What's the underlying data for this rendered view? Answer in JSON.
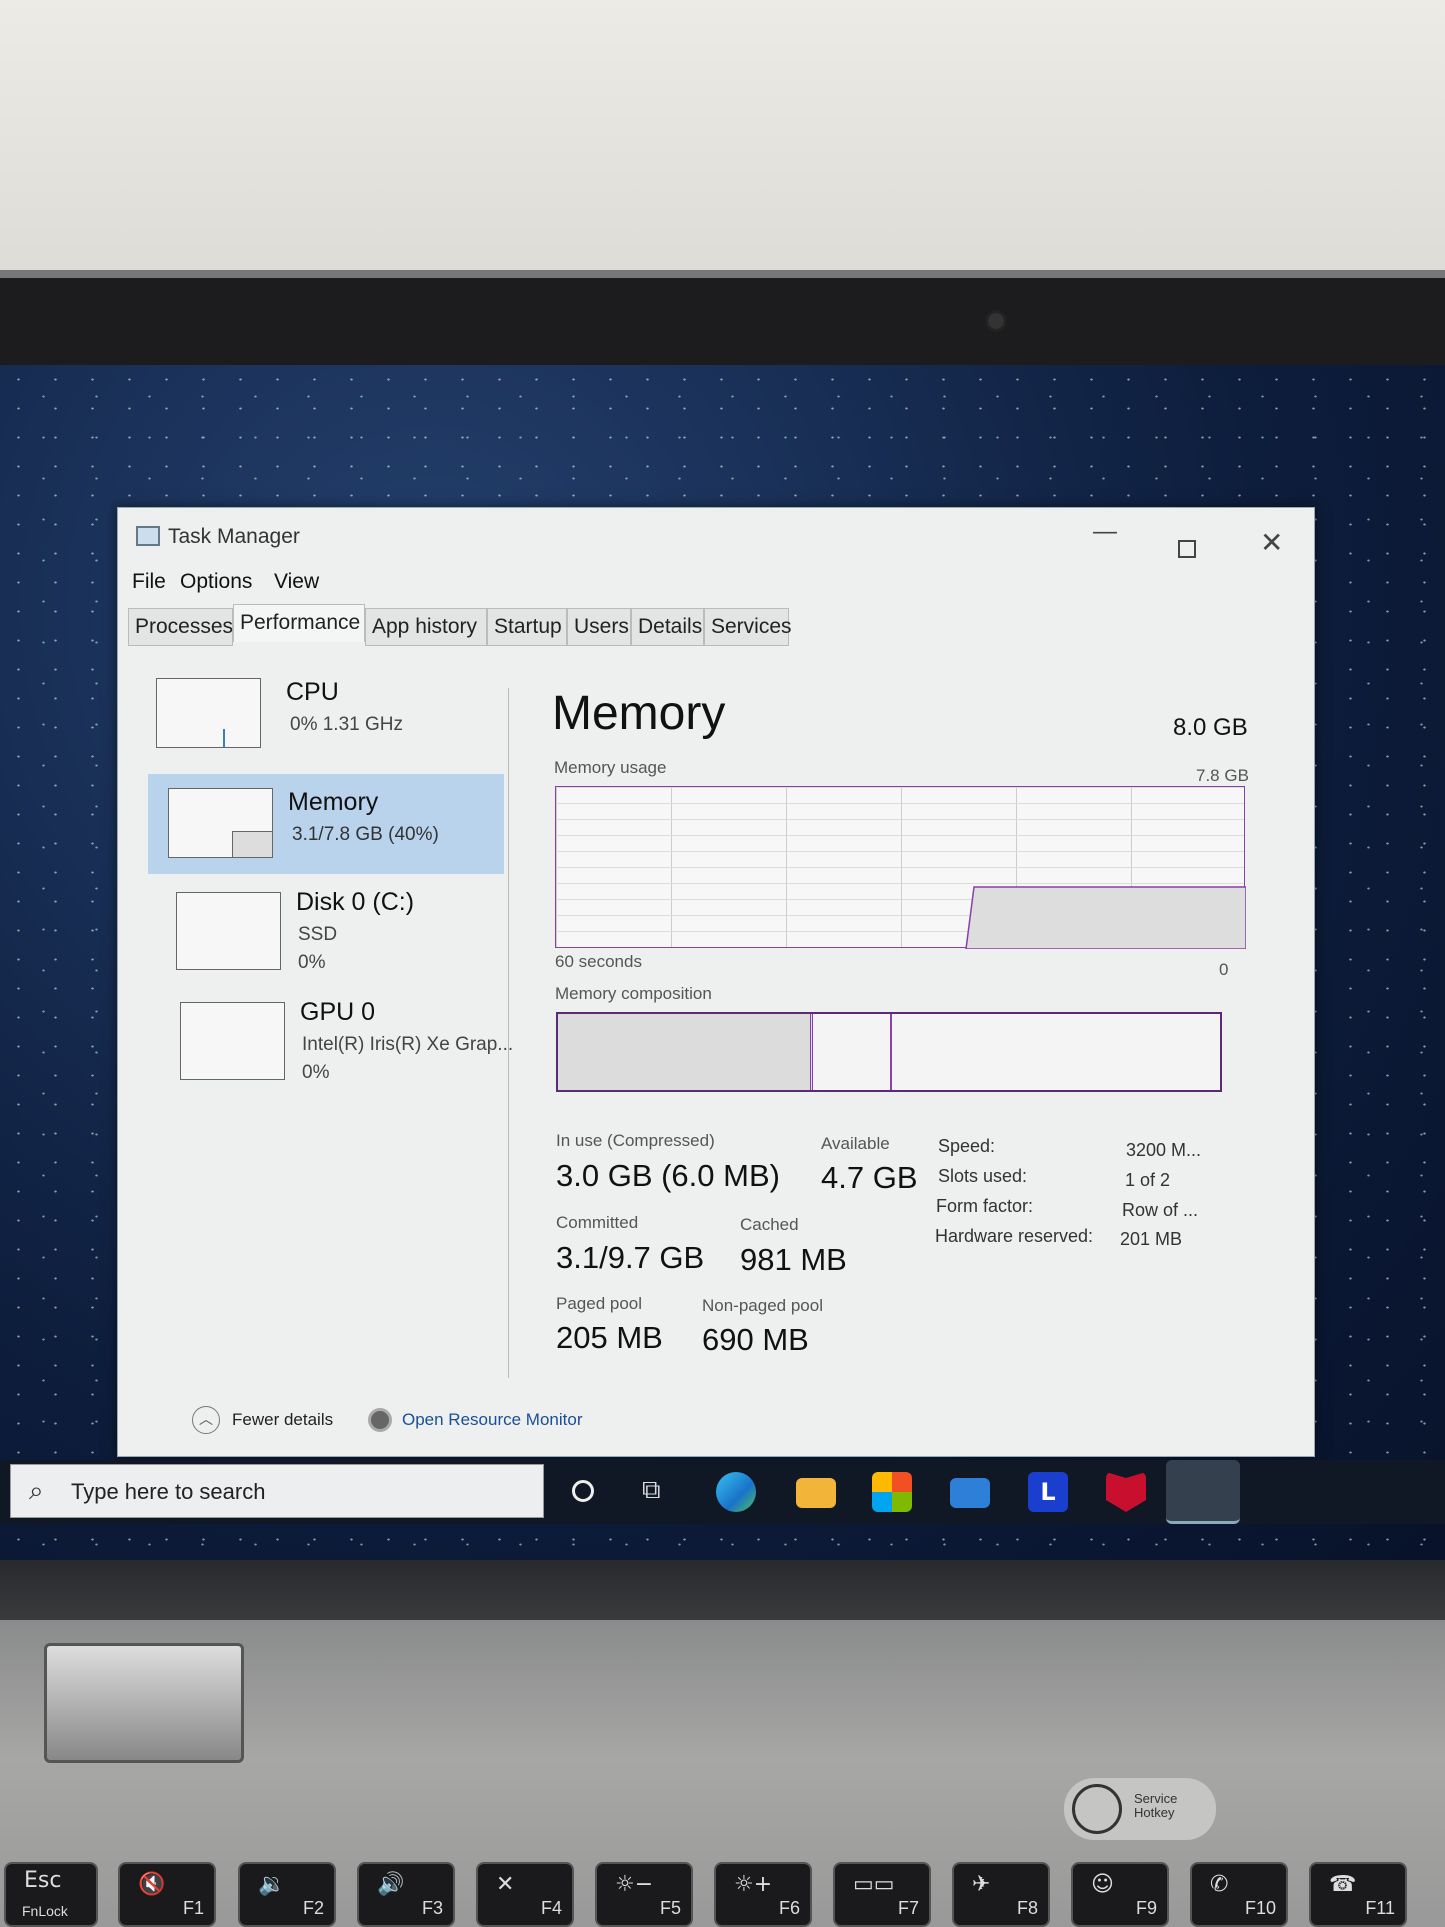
{
  "window": {
    "title": "Task Manager",
    "menu": [
      "File",
      "Options",
      "View"
    ],
    "tabs": [
      "Processes",
      "Performance",
      "App history",
      "Startup",
      "Users",
      "Details",
      "Services"
    ],
    "active_tab": "Performance"
  },
  "sidebar": [
    {
      "name": "CPU",
      "line1": "0%  1.31 GHz"
    },
    {
      "name": "Memory",
      "line1": "3.1/7.8 GB (40%)",
      "selected": true
    },
    {
      "name": "Disk 0 (C:)",
      "line1": "SSD",
      "line2": "0%"
    },
    {
      "name": "GPU 0",
      "line1": "Intel(R) Iris(R) Xe Grap...",
      "line2": "0%"
    }
  ],
  "main": {
    "title": "Memory",
    "total": "8.0 GB",
    "usage_label": "Memory usage",
    "usage_max": "7.8 GB",
    "time_label": "60 seconds",
    "zero": "0",
    "composition_label": "Memory composition",
    "usage_percent": 40,
    "stats": [
      {
        "label": "In use (Compressed)",
        "value": "3.0 GB (6.0 MB)"
      },
      {
        "label": "Available",
        "value": "4.7 GB"
      },
      {
        "label": "Committed",
        "value": "3.1/9.7 GB"
      },
      {
        "label": "Cached",
        "value": "981 MB"
      },
      {
        "label": "Paged pool",
        "value": "205 MB"
      },
      {
        "label": "Non-paged pool",
        "value": "690 MB"
      }
    ],
    "specs": [
      {
        "label": "Speed:",
        "value": "3200 M..."
      },
      {
        "label": "Slots used:",
        "value": "1 of 2"
      },
      {
        "label": "Form factor:",
        "value": "Row of ..."
      },
      {
        "label": "Hardware reserved:",
        "value": "201 MB"
      }
    ]
  },
  "footer": {
    "fewer": "Fewer details",
    "monitor": "Open Resource Monitor"
  },
  "taskbar": {
    "search_placeholder": "Type here to search"
  },
  "laptop": {
    "service_hotkey": "Service Hotkey",
    "keys": [
      {
        "top": "Esc",
        "sub": "FnLock"
      },
      "F1",
      "F2",
      "F3",
      "F4",
      "F5",
      "F6",
      "F7",
      "F8",
      "F9",
      "F10",
      "F11"
    ]
  },
  "colors": {
    "selection": "#b9d3ec",
    "memory_line": "#8b3fa8"
  }
}
